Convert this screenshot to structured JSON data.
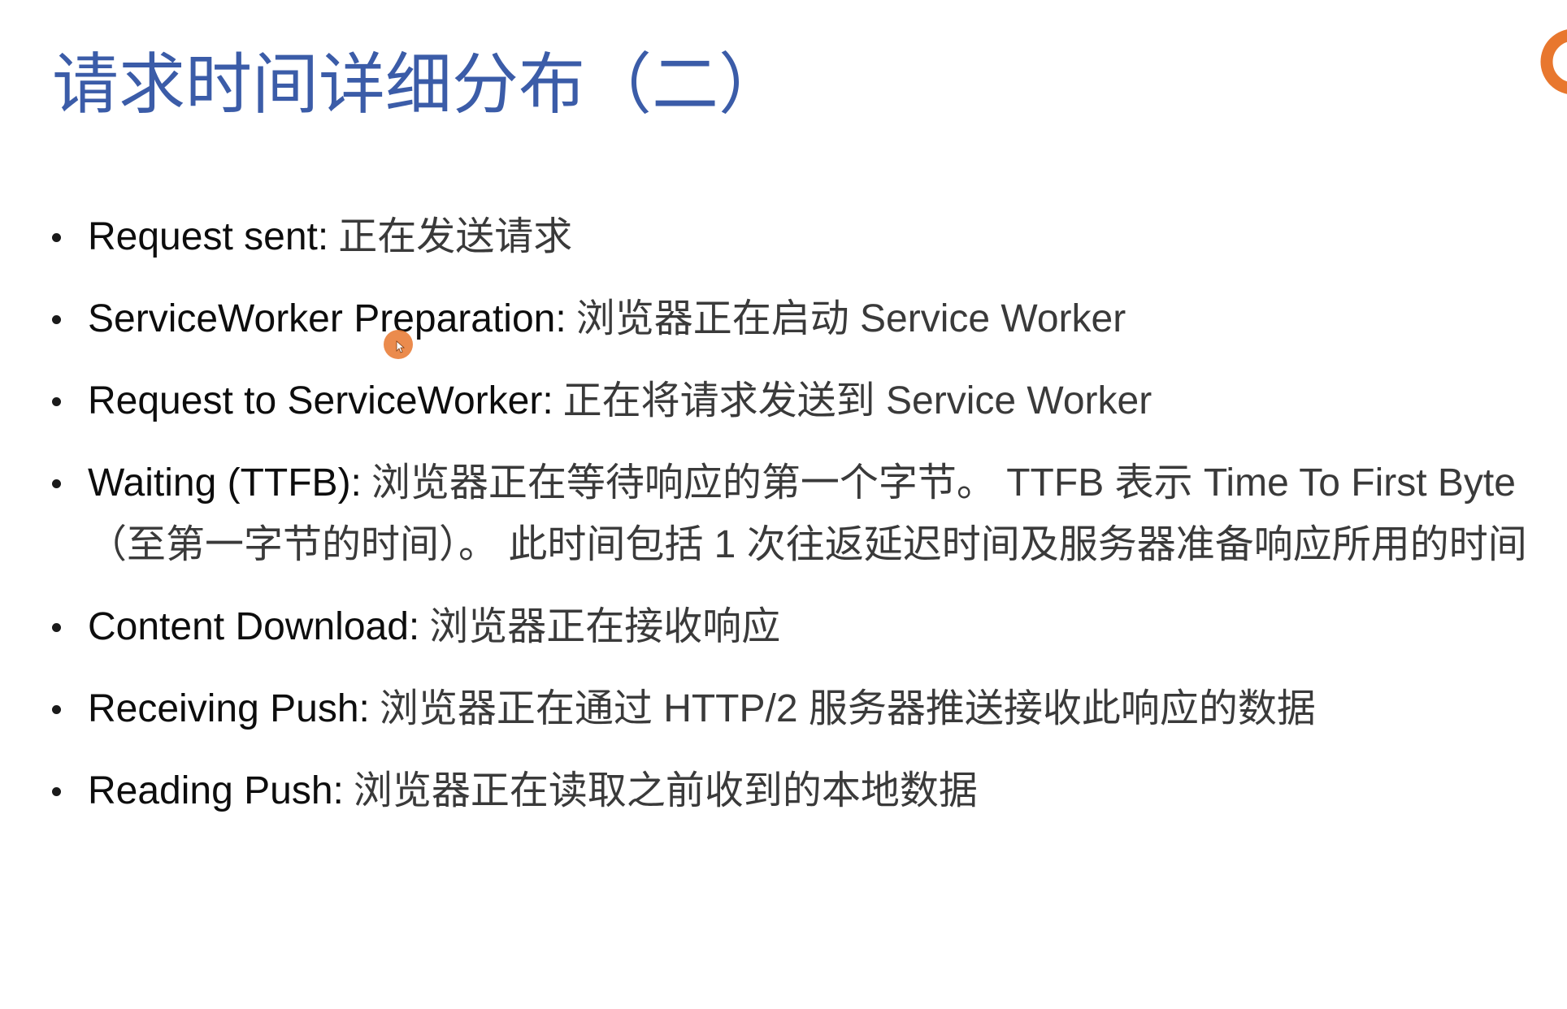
{
  "slide": {
    "title": "请求时间详细分布（二）",
    "items": [
      {
        "label": "Request sent:",
        "desc": "正在发送请求"
      },
      {
        "label": "ServiceWorker Preparation:",
        "desc": "浏览器正在启动 Service Worker"
      },
      {
        "label": "Request to ServiceWorker:",
        "desc": "正在将请求发送到 Service Worker"
      },
      {
        "label": "Waiting (TTFB):",
        "desc": "浏览器正在等待响应的第一个字节。 TTFB 表示 Time To First Byte （至第一字节的时间）。 此时间包括 1 次往返延迟时间及服务器准备响应所用的时间"
      },
      {
        "label": "Content Download:",
        "desc": "浏览器正在接收响应"
      },
      {
        "label": "Receiving Push:",
        "desc": "浏览器正在通过 HTTP/2 服务器推送接收此响应的数据"
      },
      {
        "label": "Reading Push:",
        "desc": "浏览器正在读取之前收到的本地数据"
      }
    ]
  },
  "colors": {
    "title": "#3b5ca8",
    "text": "#0d0d0d",
    "logo": "#e8772e",
    "cursor": "#e8772e"
  },
  "icons": {
    "logo": "orange-logo-icon",
    "cursor": "mouse-cursor-icon"
  }
}
